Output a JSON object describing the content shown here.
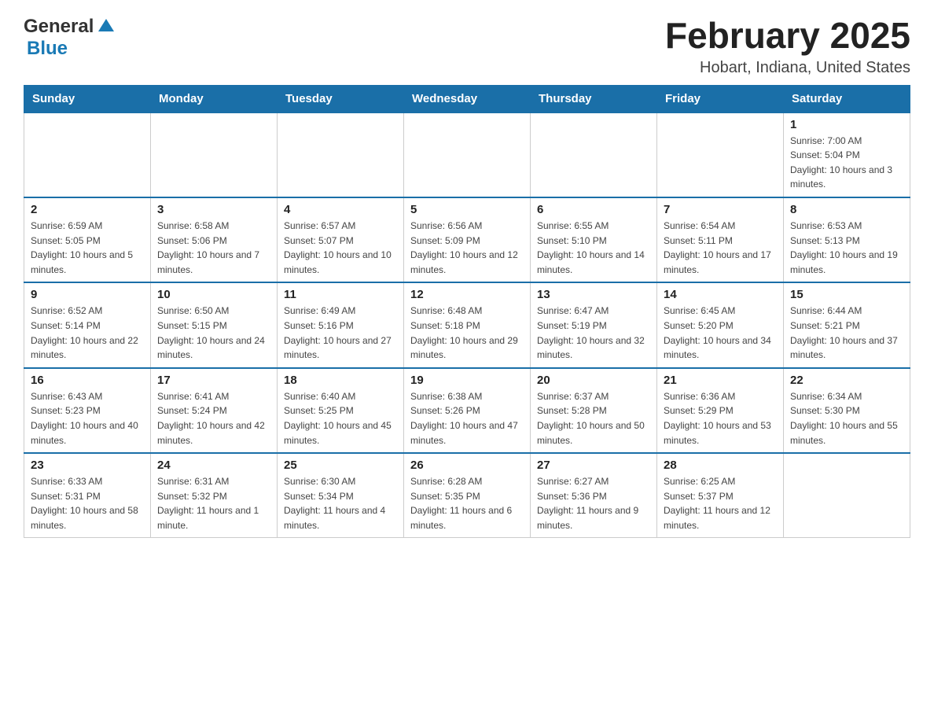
{
  "header": {
    "logo": {
      "general": "General",
      "blue": "Blue",
      "aria": "GeneralBlue logo"
    },
    "title": "February 2025",
    "location": "Hobart, Indiana, United States"
  },
  "weekdays": [
    "Sunday",
    "Monday",
    "Tuesday",
    "Wednesday",
    "Thursday",
    "Friday",
    "Saturday"
  ],
  "weeks": [
    [
      {
        "day": "",
        "sunrise": "",
        "sunset": "",
        "daylight": ""
      },
      {
        "day": "",
        "sunrise": "",
        "sunset": "",
        "daylight": ""
      },
      {
        "day": "",
        "sunrise": "",
        "sunset": "",
        "daylight": ""
      },
      {
        "day": "",
        "sunrise": "",
        "sunset": "",
        "daylight": ""
      },
      {
        "day": "",
        "sunrise": "",
        "sunset": "",
        "daylight": ""
      },
      {
        "day": "",
        "sunrise": "",
        "sunset": "",
        "daylight": ""
      },
      {
        "day": "1",
        "sunrise": "Sunrise: 7:00 AM",
        "sunset": "Sunset: 5:04 PM",
        "daylight": "Daylight: 10 hours and 3 minutes."
      }
    ],
    [
      {
        "day": "2",
        "sunrise": "Sunrise: 6:59 AM",
        "sunset": "Sunset: 5:05 PM",
        "daylight": "Daylight: 10 hours and 5 minutes."
      },
      {
        "day": "3",
        "sunrise": "Sunrise: 6:58 AM",
        "sunset": "Sunset: 5:06 PM",
        "daylight": "Daylight: 10 hours and 7 minutes."
      },
      {
        "day": "4",
        "sunrise": "Sunrise: 6:57 AM",
        "sunset": "Sunset: 5:07 PM",
        "daylight": "Daylight: 10 hours and 10 minutes."
      },
      {
        "day": "5",
        "sunrise": "Sunrise: 6:56 AM",
        "sunset": "Sunset: 5:09 PM",
        "daylight": "Daylight: 10 hours and 12 minutes."
      },
      {
        "day": "6",
        "sunrise": "Sunrise: 6:55 AM",
        "sunset": "Sunset: 5:10 PM",
        "daylight": "Daylight: 10 hours and 14 minutes."
      },
      {
        "day": "7",
        "sunrise": "Sunrise: 6:54 AM",
        "sunset": "Sunset: 5:11 PM",
        "daylight": "Daylight: 10 hours and 17 minutes."
      },
      {
        "day": "8",
        "sunrise": "Sunrise: 6:53 AM",
        "sunset": "Sunset: 5:13 PM",
        "daylight": "Daylight: 10 hours and 19 minutes."
      }
    ],
    [
      {
        "day": "9",
        "sunrise": "Sunrise: 6:52 AM",
        "sunset": "Sunset: 5:14 PM",
        "daylight": "Daylight: 10 hours and 22 minutes."
      },
      {
        "day": "10",
        "sunrise": "Sunrise: 6:50 AM",
        "sunset": "Sunset: 5:15 PM",
        "daylight": "Daylight: 10 hours and 24 minutes."
      },
      {
        "day": "11",
        "sunrise": "Sunrise: 6:49 AM",
        "sunset": "Sunset: 5:16 PM",
        "daylight": "Daylight: 10 hours and 27 minutes."
      },
      {
        "day": "12",
        "sunrise": "Sunrise: 6:48 AM",
        "sunset": "Sunset: 5:18 PM",
        "daylight": "Daylight: 10 hours and 29 minutes."
      },
      {
        "day": "13",
        "sunrise": "Sunrise: 6:47 AM",
        "sunset": "Sunset: 5:19 PM",
        "daylight": "Daylight: 10 hours and 32 minutes."
      },
      {
        "day": "14",
        "sunrise": "Sunrise: 6:45 AM",
        "sunset": "Sunset: 5:20 PM",
        "daylight": "Daylight: 10 hours and 34 minutes."
      },
      {
        "day": "15",
        "sunrise": "Sunrise: 6:44 AM",
        "sunset": "Sunset: 5:21 PM",
        "daylight": "Daylight: 10 hours and 37 minutes."
      }
    ],
    [
      {
        "day": "16",
        "sunrise": "Sunrise: 6:43 AM",
        "sunset": "Sunset: 5:23 PM",
        "daylight": "Daylight: 10 hours and 40 minutes."
      },
      {
        "day": "17",
        "sunrise": "Sunrise: 6:41 AM",
        "sunset": "Sunset: 5:24 PM",
        "daylight": "Daylight: 10 hours and 42 minutes."
      },
      {
        "day": "18",
        "sunrise": "Sunrise: 6:40 AM",
        "sunset": "Sunset: 5:25 PM",
        "daylight": "Daylight: 10 hours and 45 minutes."
      },
      {
        "day": "19",
        "sunrise": "Sunrise: 6:38 AM",
        "sunset": "Sunset: 5:26 PM",
        "daylight": "Daylight: 10 hours and 47 minutes."
      },
      {
        "day": "20",
        "sunrise": "Sunrise: 6:37 AM",
        "sunset": "Sunset: 5:28 PM",
        "daylight": "Daylight: 10 hours and 50 minutes."
      },
      {
        "day": "21",
        "sunrise": "Sunrise: 6:36 AM",
        "sunset": "Sunset: 5:29 PM",
        "daylight": "Daylight: 10 hours and 53 minutes."
      },
      {
        "day": "22",
        "sunrise": "Sunrise: 6:34 AM",
        "sunset": "Sunset: 5:30 PM",
        "daylight": "Daylight: 10 hours and 55 minutes."
      }
    ],
    [
      {
        "day": "23",
        "sunrise": "Sunrise: 6:33 AM",
        "sunset": "Sunset: 5:31 PM",
        "daylight": "Daylight: 10 hours and 58 minutes."
      },
      {
        "day": "24",
        "sunrise": "Sunrise: 6:31 AM",
        "sunset": "Sunset: 5:32 PM",
        "daylight": "Daylight: 11 hours and 1 minute."
      },
      {
        "day": "25",
        "sunrise": "Sunrise: 6:30 AM",
        "sunset": "Sunset: 5:34 PM",
        "daylight": "Daylight: 11 hours and 4 minutes."
      },
      {
        "day": "26",
        "sunrise": "Sunrise: 6:28 AM",
        "sunset": "Sunset: 5:35 PM",
        "daylight": "Daylight: 11 hours and 6 minutes."
      },
      {
        "day": "27",
        "sunrise": "Sunrise: 6:27 AM",
        "sunset": "Sunset: 5:36 PM",
        "daylight": "Daylight: 11 hours and 9 minutes."
      },
      {
        "day": "28",
        "sunrise": "Sunrise: 6:25 AM",
        "sunset": "Sunset: 5:37 PM",
        "daylight": "Daylight: 11 hours and 12 minutes."
      },
      {
        "day": "",
        "sunrise": "",
        "sunset": "",
        "daylight": ""
      }
    ]
  ]
}
